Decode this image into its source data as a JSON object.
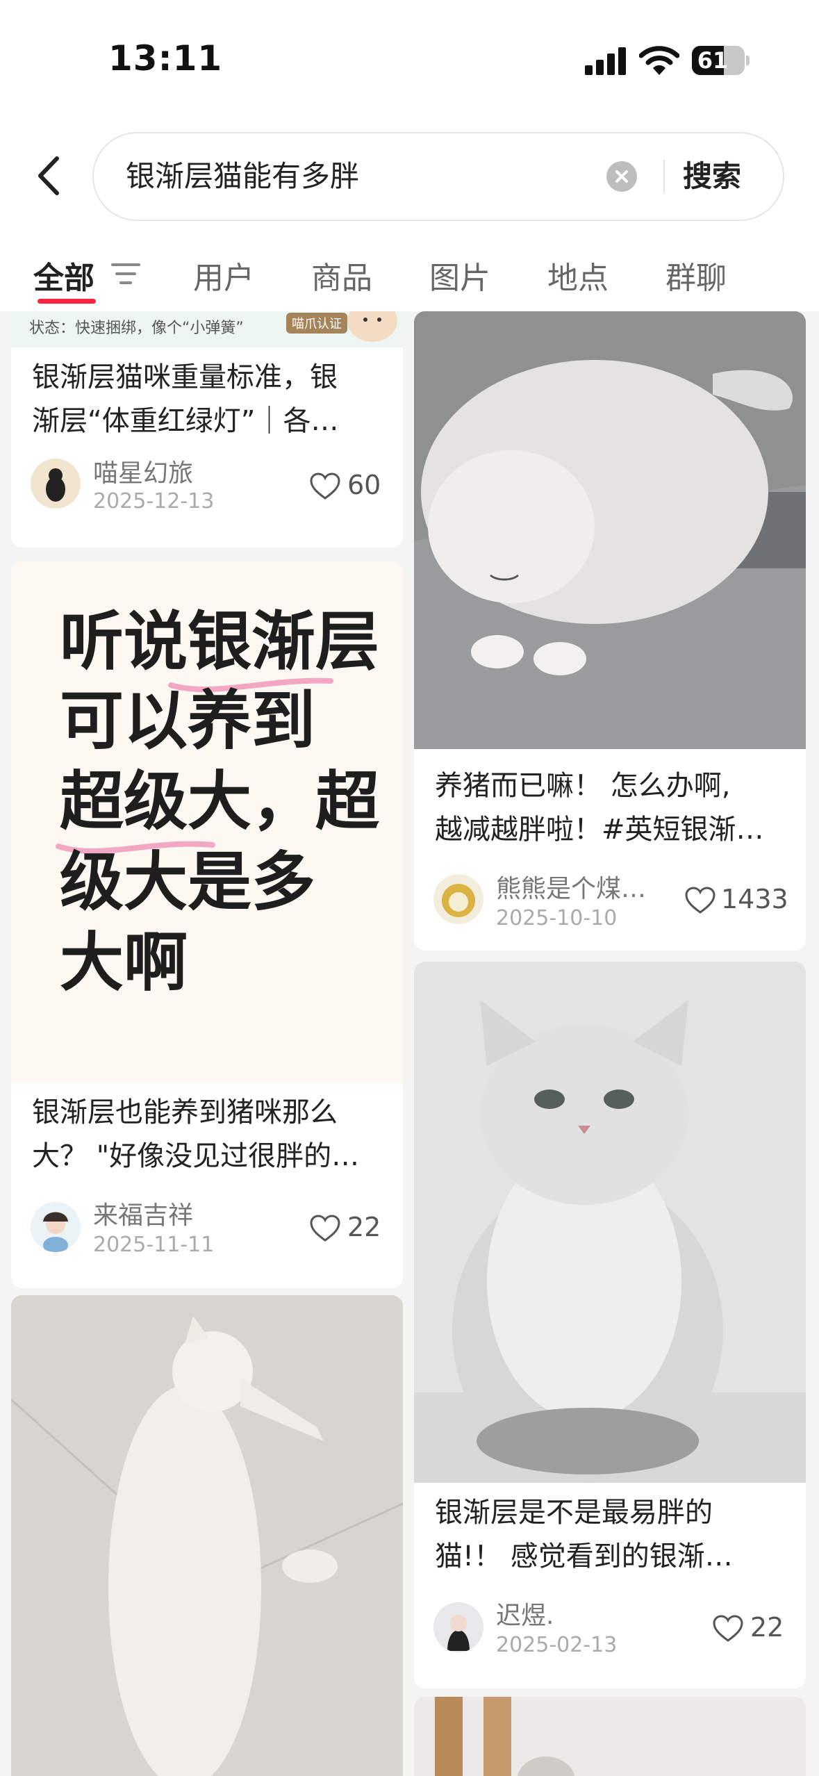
{
  "status_bar": {
    "time": "13:11",
    "battery": "61",
    "battery_level": 0.61
  },
  "search": {
    "query": "银渐层猫能有多胖",
    "submit_label": "搜索"
  },
  "tabs": [
    {
      "label": "全部",
      "active": true
    },
    {
      "label": "用户"
    },
    {
      "label": "商品"
    },
    {
      "label": "图片"
    },
    {
      "label": "地点"
    },
    {
      "label": "群聊"
    }
  ],
  "cards": [
    {
      "image_caption": "状态：快速捆绑，像个“小弹簧”",
      "image_badge": "喵爪认证",
      "title_line1": "银渐层猫咪重量标准，银",
      "title_line2": "渐层“体重红绿灯”｜各…",
      "author": "喵星幻旅",
      "date": "2025-12-13",
      "likes": "60"
    },
    {
      "title_line1": "养猪而已嘛！ 怎么办啊,",
      "title_line2": "越减越胖啦！#英短银渐…",
      "author": "熊熊是个煤…",
      "date": "2025-10-10",
      "likes": "1433"
    },
    {
      "image_text": [
        "听说银渐层",
        "可以养到",
        "超级大，超",
        "级大是多",
        "大啊"
      ],
      "title_line1": "银渐层也能养到猪咪那么",
      "title_line2": "大？ \"好像没见过很胖的…",
      "author": "来福吉祥",
      "date": "2025-11-11",
      "likes": "22"
    },
    {
      "title_line1": "银渐层是不是最易胖的",
      "title_line2": "猫!！ 感觉看到的银渐…",
      "author": "迟煜.",
      "date": "2025-02-13",
      "likes": "22"
    }
  ]
}
